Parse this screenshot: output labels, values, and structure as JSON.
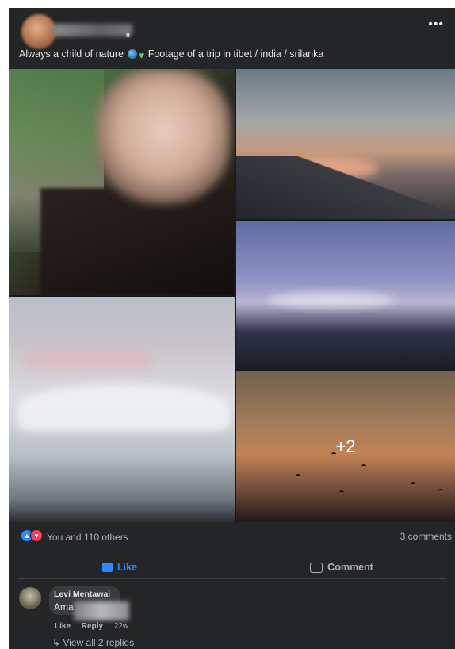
{
  "post": {
    "more_label": "•••",
    "header_glyph": "ᵻᵻ",
    "caption_before": "Always a child of nature ",
    "caption_after": " Footage of a trip in tibet / india / srilanka",
    "caption_emojis": [
      "globe-emoji",
      "green-heart-emoji"
    ]
  },
  "gallery": {
    "extra_count": "+2"
  },
  "reactions": {
    "icons": [
      "like-reaction-icon",
      "love-reaction-icon"
    ],
    "text": "You and 110 others",
    "comments": "3 comments"
  },
  "actions": {
    "like": "Like",
    "comment": "Comment"
  },
  "comment": {
    "author": "Levi Mentawai",
    "text": "Ama",
    "like": "Like",
    "reply": "Reply",
    "time": "22w",
    "view_replies": "↳ View all 2 replies"
  },
  "colors": {
    "card_bg": "#242526",
    "accent": "#2d88ff",
    "love": "#f33e58",
    "text_primary": "#e4e6eb",
    "text_secondary": "#b0b3b8"
  }
}
